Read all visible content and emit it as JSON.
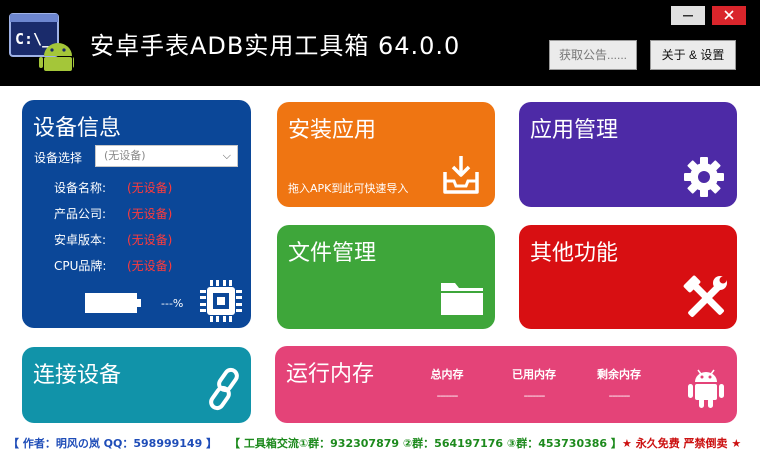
{
  "window": {
    "title": "安卓手表ADB实用工具箱  64.0.0",
    "minimize_label": "—",
    "close_label": "✕"
  },
  "toolbar": {
    "announcement_label": "获取公告......",
    "about_label": "关于 & 设置"
  },
  "app_icon": {
    "text": "C:\\_"
  },
  "device_info": {
    "title": "设备信息",
    "select_label": "设备选择",
    "select_value": "(无设备)",
    "rows": [
      {
        "label": "设备名称:",
        "value": "(无设备)"
      },
      {
        "label": "产品公司:",
        "value": "(无设备)"
      },
      {
        "label": "安卓版本:",
        "value": "(无设备)"
      },
      {
        "label": "CPU品牌:",
        "value": "(无设备)"
      }
    ],
    "battery_text": "---%"
  },
  "install_app": {
    "title": "安装应用",
    "hint": "拖入APK到此可快速导入"
  },
  "app_manage": {
    "title": "应用管理"
  },
  "file_manage": {
    "title": "文件管理"
  },
  "other_functions": {
    "title": "其他功能"
  },
  "connect_device": {
    "title": "连接设备"
  },
  "memory": {
    "title": "运行内存",
    "columns": [
      {
        "label": "总内存",
        "value": "-------"
      },
      {
        "label": "已用内存",
        "value": "-------"
      },
      {
        "label": "剩余内存",
        "value": "-------"
      }
    ]
  },
  "footer": {
    "author": "【 作者：明风の岚   QQ：598999149 】",
    "groups": "【 工具箱交流①群：932307879  ②群：564197176  ③群：453730386 】",
    "notice": "★ 永久免费 严禁倒卖 ★"
  },
  "colors": {
    "device_tile": "#0b4798",
    "install_tile": "#ef7512",
    "apps_tile": "#4d2aa6",
    "files_tile": "#3ea63a",
    "other_tile": "#d80f12",
    "connect_tile": "#1193a9",
    "memory_tile": "#e44378",
    "value_red": "#ff3b3b"
  }
}
